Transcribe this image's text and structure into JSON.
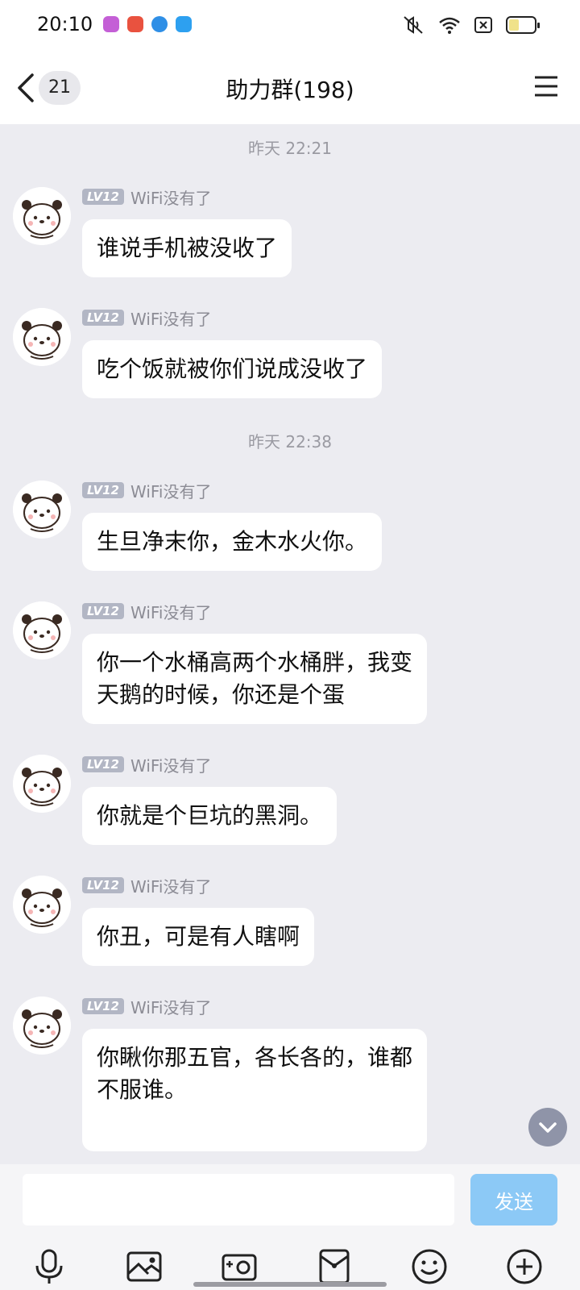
{
  "status": {
    "time": "20:10",
    "app_icons": [
      "#c45fd6",
      "#e9523f",
      "#2f8fe6",
      "#2da0f0"
    ]
  },
  "header": {
    "back_count": "21",
    "title": "助力群(198)"
  },
  "chat": {
    "time_separators": [
      "昨天 22:21",
      "昨天 22:38"
    ],
    "messages": [
      {
        "level": "LV12",
        "sender": "WiFi没有了",
        "lines": [
          "谁说手机被没收了"
        ]
      },
      {
        "level": "LV12",
        "sender": "WiFi没有了",
        "lines": [
          "吃个饭就被你们说成没收了"
        ]
      },
      {
        "level": "LV12",
        "sender": "WiFi没有了",
        "lines": [
          "生旦净末你，金木水火你。"
        ]
      },
      {
        "level": "LV12",
        "sender": "WiFi没有了",
        "lines": [
          "你一个水桶高两个水桶胖，我变",
          "天鹅的时候，你还是个蛋"
        ]
      },
      {
        "level": "LV12",
        "sender": "WiFi没有了",
        "lines": [
          "你就是个巨坑的黑洞。"
        ]
      },
      {
        "level": "LV12",
        "sender": "WiFi没有了",
        "lines": [
          "你丑，可是有人瞎啊"
        ]
      },
      {
        "level": "LV12",
        "sender": "WiFi没有了",
        "lines": [
          "你瞅你那五官，各长各的，谁都",
          "不服谁。"
        ]
      }
    ]
  },
  "composer": {
    "input_value": "",
    "send_label": "发送"
  },
  "toolbar_icons": [
    "microphone-icon",
    "image-icon",
    "camera-icon",
    "red-packet-icon",
    "emoji-icon",
    "plus-icon"
  ]
}
